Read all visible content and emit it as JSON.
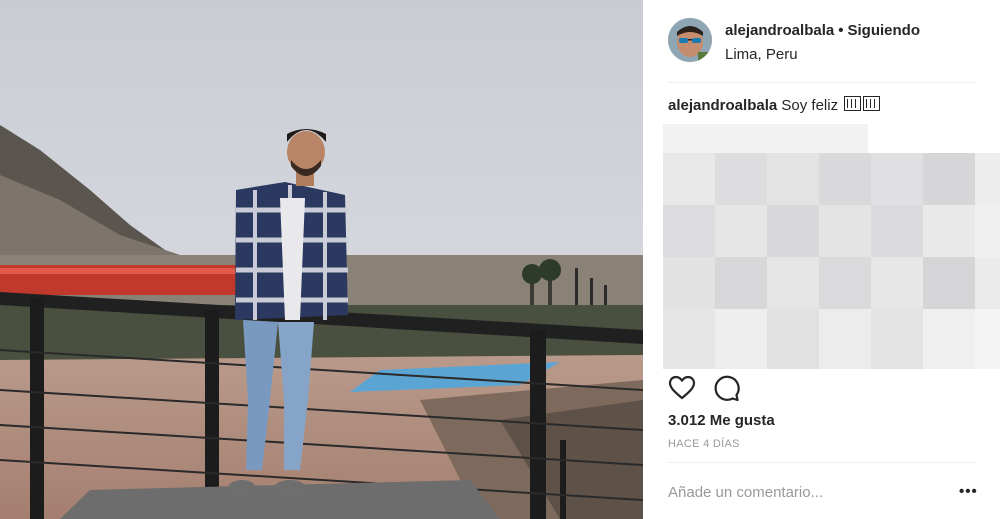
{
  "post": {
    "username": "alejandroalbala",
    "separator": "•",
    "follow_status": "Siguiendo",
    "location": "Lima, Peru",
    "caption_user": "alejandroalbala",
    "caption_text": "Soy feliz",
    "likes": "3.012 Me gusta",
    "timestamp": "HACE 4 DÍAS"
  },
  "comment_box": {
    "placeholder": "Añade un comentario..."
  },
  "more_options": {
    "label": "•••"
  },
  "icons": {
    "like": "heart-icon",
    "comment": "comment-bubble-icon",
    "more": "more-options-icon"
  },
  "colors": {
    "text": "#262626",
    "muted": "#999999",
    "separator": "#efefef"
  }
}
